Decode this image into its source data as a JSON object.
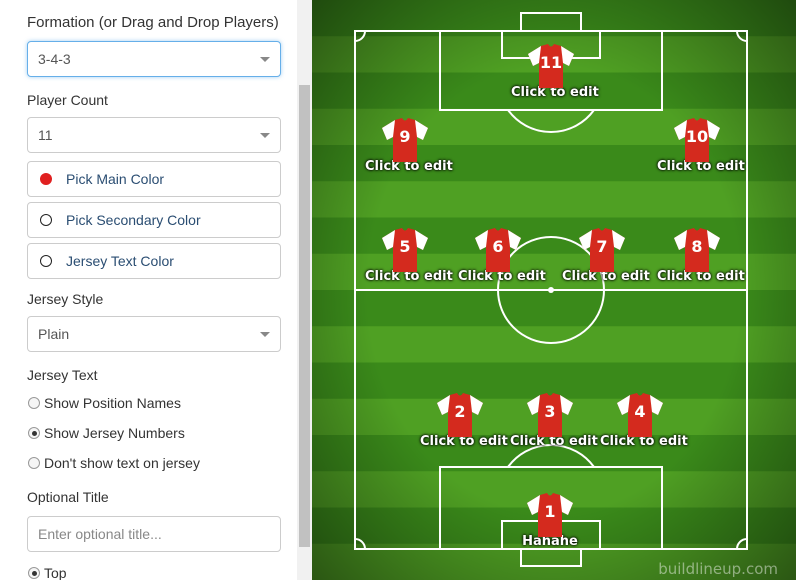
{
  "sidebar": {
    "formation_label": "Formation (or Drag and Drop Players)",
    "formation_value": "3-4-3",
    "player_count_label": "Player Count",
    "player_count_value": "11",
    "main_color_label": "Pick Main Color",
    "secondary_color_label": "Pick Secondary Color",
    "jersey_text_color_label": "Jersey Text Color",
    "main_color": "#e02020",
    "jersey_style_label": "Jersey Style",
    "jersey_style_value": "Plain",
    "jersey_text_label": "Jersey Text",
    "radio_options": [
      "Show Position Names",
      "Show Jersey Numbers",
      "Don't show text on jersey"
    ],
    "radio_selected": 1,
    "optional_title_label": "Optional Title",
    "optional_title_placeholder": "Enter optional title...",
    "title_position_label": "Top"
  },
  "pitch": {
    "grass_dark": "#3a8a1a",
    "grass_light": "#4fa023",
    "jersey_color": "#d42a1e",
    "sleeve_color": "#ffffff",
    "watermark": "buildlineup.com",
    "players": [
      {
        "number": "11",
        "name": "Click to edit"
      },
      {
        "number": "9",
        "name": "Click to edit"
      },
      {
        "number": "10",
        "name": "Click to edit"
      },
      {
        "number": "5",
        "name": "Click to edit"
      },
      {
        "number": "6",
        "name": "Click to edit"
      },
      {
        "number": "7",
        "name": "Click to edit"
      },
      {
        "number": "8",
        "name": "Click to edit"
      },
      {
        "number": "2",
        "name": "Click to edit"
      },
      {
        "number": "3",
        "name": "Click to edit"
      },
      {
        "number": "4",
        "name": "Click to edit"
      },
      {
        "number": "1",
        "name": "Hahahe"
      }
    ]
  }
}
